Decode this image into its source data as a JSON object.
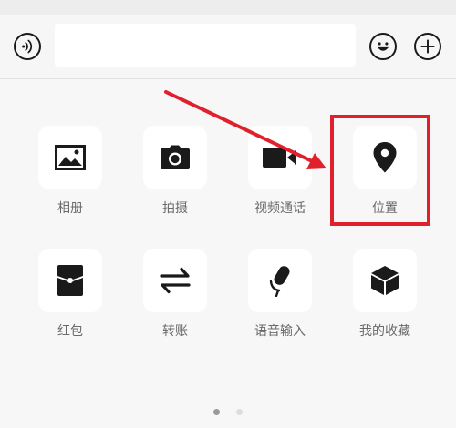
{
  "input_bar": {
    "text_value": "",
    "voice_icon": "voice-icon",
    "emoji_icon": "emoji-icon",
    "plus_icon": "plus-icon"
  },
  "grid": {
    "items": [
      {
        "label": "相册",
        "icon": "photo-icon"
      },
      {
        "label": "拍摄",
        "icon": "camera-icon"
      },
      {
        "label": "视频通话",
        "icon": "video-call-icon"
      },
      {
        "label": "位置",
        "icon": "location-pin-icon"
      },
      {
        "label": "红包",
        "icon": "red-packet-icon"
      },
      {
        "label": "转账",
        "icon": "transfer-icon"
      },
      {
        "label": "语音输入",
        "icon": "microphone-icon"
      },
      {
        "label": "我的收藏",
        "icon": "favorites-cube-icon"
      }
    ]
  },
  "pagination": {
    "current_page": 1,
    "total_pages": 2,
    "active_color": "#999999",
    "inactive_color": "#dddddd"
  },
  "annotation": {
    "color": "#e0212d",
    "highlighted_item": "位置"
  }
}
